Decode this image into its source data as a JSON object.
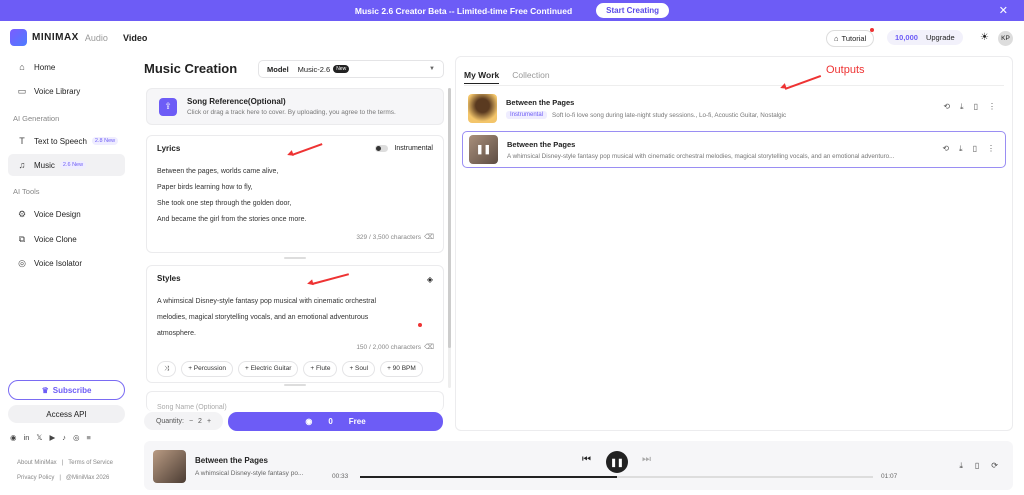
{
  "banner": {
    "text": "Music 2.6 Creator Beta -- Limited-time Free Continued",
    "button": "Start Creating",
    "close": "✕"
  },
  "header": {
    "logo": "MINIMAX",
    "logo_sub": "Audio",
    "video": "Video",
    "tutorial": "Tutorial",
    "credits": "10,000",
    "upgrade": "Upgrade",
    "avatar": "KP"
  },
  "sidebar": {
    "home": "Home",
    "voice_library": "Voice Library",
    "sec_ai_generation": "AI Generation",
    "tts": "Text to Speech",
    "tts_badge": "2.8 New",
    "music": "Music",
    "music_badge": "2.6 New",
    "sec_ai_tools": "AI Tools",
    "voice_design": "Voice Design",
    "voice_clone": "Voice Clone",
    "voice_isolator": "Voice Isolator",
    "subscribe": "Subscribe",
    "access_api": "Access API",
    "about": "About MiniMax",
    "terms": "Terms of Service",
    "privacy": "Privacy Policy",
    "copyright": "@MiniMax 2026"
  },
  "music": {
    "title": "Music Creation",
    "model_label": "Model",
    "model_value": "Music-2.6",
    "model_badge": "New",
    "songref_title": "Song Reference(Optional)",
    "songref_sub": "Click or drag a track here to cover. By uploading, you agree to the terms.",
    "lyrics_title": "Lyrics",
    "instrumental": "Instrumental",
    "lyrics": [
      "Between the pages, worlds came alive,",
      "Paper birds learning how to fly,",
      "She took one step through the golden door,",
      "And became the girl from the stories once more."
    ],
    "lyrics_count": "329 / 3,500 characters",
    "styles_title": "Styles",
    "styles_lines": [
      "A whimsical Disney-style fantasy pop musical with cinematic orchestral",
      "melodies, magical storytelling vocals, and an emotional adventurous",
      "atmosphere."
    ],
    "styles_count": "150 / 2,000 characters",
    "tags": [
      "+ Percussion",
      "+ Electric Guitar",
      "+ Flute",
      "+ Soul",
      "+ 90 BPM"
    ],
    "song_name_placeholder": "Song Name (Optional)",
    "quantity": "Quantity:",
    "quantity_value": "2",
    "generate_credits": "0",
    "generate_free": "Free"
  },
  "outputs": {
    "tab_my_work": "My Work",
    "tab_collection": "Collection",
    "tracks": [
      {
        "title": "Between the Pages",
        "badge": "Instrumental",
        "desc": "Soft lo-fi love song during late-night study sessions., Lo-fi, Acoustic Guitar, Nostalgic"
      },
      {
        "title": "Between the Pages",
        "desc": "A whimsical Disney-style fantasy pop musical with cinematic orchestral melodies, magical storytelling vocals, and an emotional adventuro..."
      }
    ]
  },
  "annotations": {
    "outputs": "Outputs"
  },
  "player": {
    "title": "Between the Pages",
    "desc": "A whimsical Disney-style fantasy po...",
    "current": "00:33",
    "duration": "01:07",
    "progress": 0.5
  },
  "colors": {
    "accent": "#6d5cf6",
    "annotation": "#e33333"
  }
}
